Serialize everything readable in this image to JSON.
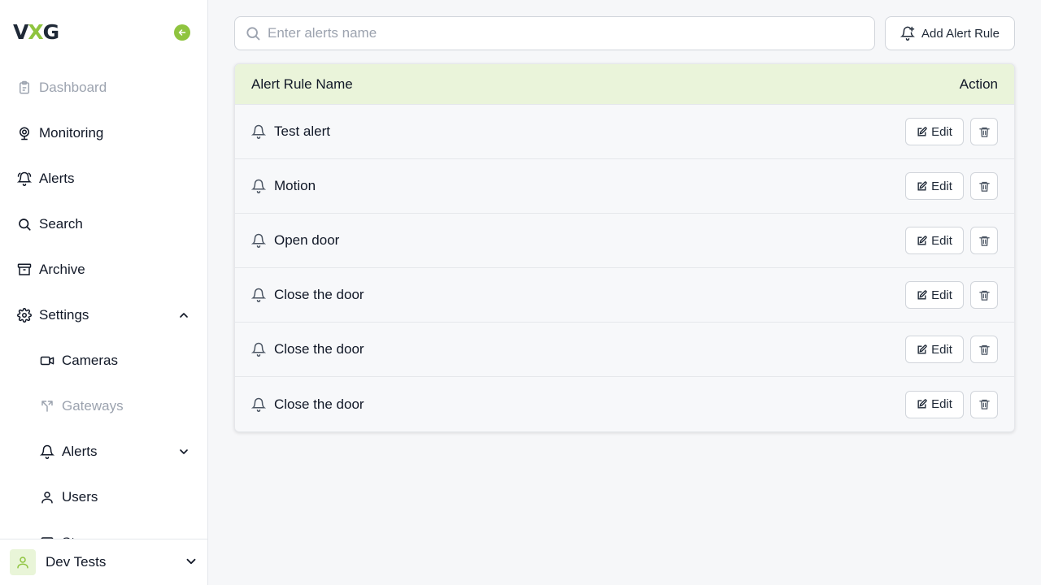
{
  "brand": {
    "logo_left": "V",
    "logo_x": "X",
    "logo_right": "G",
    "accent": "#8fc43f"
  },
  "sidebar": {
    "items": [
      {
        "label": "Dashboard",
        "icon": "clipboard-icon",
        "disabled": true
      },
      {
        "label": "Monitoring",
        "icon": "webcam-icon"
      },
      {
        "label": "Alerts",
        "icon": "bell-ring-icon"
      },
      {
        "label": "Search",
        "icon": "search-icon"
      },
      {
        "label": "Archive",
        "icon": "archive-icon"
      },
      {
        "label": "Settings",
        "icon": "gear-icon",
        "expanded": true
      },
      {
        "label": "Cameras",
        "icon": "video-icon",
        "sub": true
      },
      {
        "label": "Gateways",
        "icon": "fork-icon",
        "sub": true,
        "disabled": true
      },
      {
        "label": "Alerts",
        "icon": "bell-icon",
        "sub": true,
        "collapsible": true
      },
      {
        "label": "Users",
        "icon": "user-icon",
        "sub": true
      },
      {
        "label": "St...",
        "icon": "storage-icon",
        "sub": true
      }
    ],
    "user": {
      "name": "Dev Tests"
    }
  },
  "search": {
    "placeholder": "Enter alerts name",
    "value": ""
  },
  "toolbar": {
    "add_label": "Add Alert Rule"
  },
  "table": {
    "columns": [
      "Alert Rule Name",
      "Action"
    ],
    "rows": [
      {
        "name": "Test alert"
      },
      {
        "name": "Motion"
      },
      {
        "name": "Open door"
      },
      {
        "name": "Close the door"
      },
      {
        "name": "Close the door"
      },
      {
        "name": "Close the door"
      }
    ],
    "edit_label": "Edit"
  }
}
